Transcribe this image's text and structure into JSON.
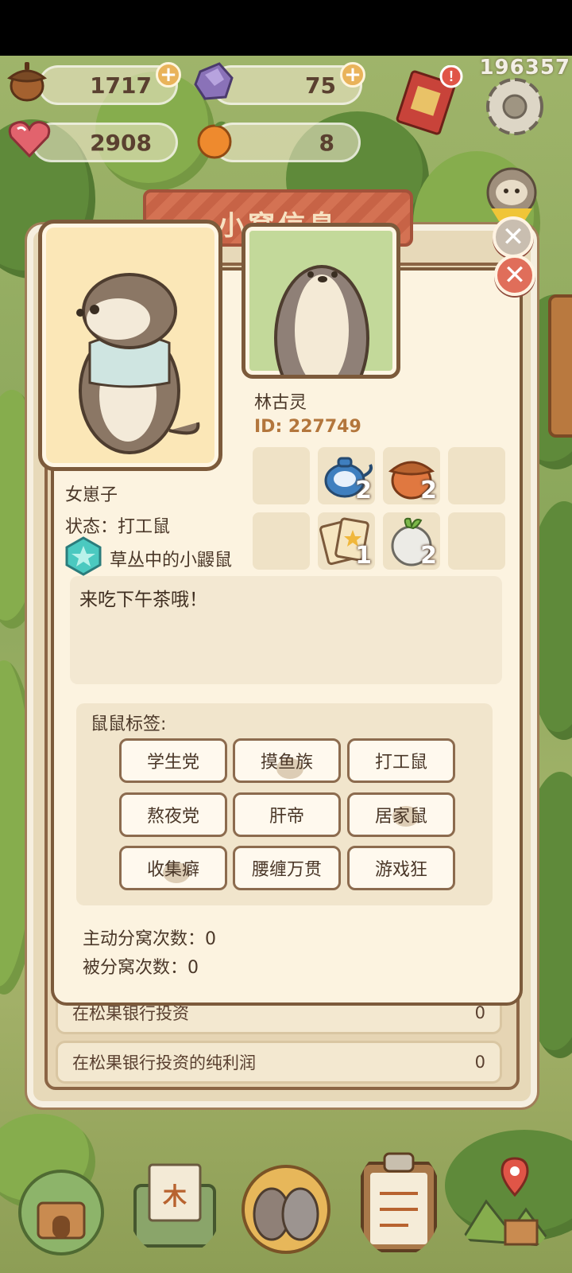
{
  "resources": [
    {
      "name": "acorn",
      "value": "1717"
    },
    {
      "name": "crystal",
      "value": "75"
    },
    {
      "name": "heart",
      "value": "2908"
    },
    {
      "name": "orange",
      "value": "8"
    }
  ],
  "player_id_corner": "196357",
  "back_panel": {
    "title": "小窝信息",
    "rows": [
      {
        "label": "在松果银行投资",
        "value": "0"
      },
      {
        "label": "在松果银行投资的纯利润",
        "value": "0"
      }
    ]
  },
  "profile": {
    "self_name": "女崽子",
    "status": "状态：打工鼠",
    "title_badge": "草丛中的小鼹鼠",
    "other_name": "林古灵",
    "other_id": "ID: 227749",
    "items": [
      {
        "name": "teapot",
        "count": "2"
      },
      {
        "name": "acorn",
        "count": "2"
      },
      {
        "name": "cards",
        "count": "1"
      },
      {
        "name": "turnip",
        "count": "2"
      }
    ],
    "message": "来吃下午茶哦！",
    "tags_title": "鼠鼠标签:",
    "tags": [
      "学生党",
      "摸鱼族",
      "打工鼠",
      "熬夜党",
      "肝帝",
      "居家鼠",
      "收集癖",
      "腰缠万贯",
      "游戏狂"
    ],
    "stats": {
      "active_split": "主动分窝次数：0",
      "passive_split": "被分窝次数：0"
    }
  },
  "colors": {
    "panel_bg": "#fcf3e0",
    "border": "#7c5a3b",
    "accent_id": "#b3763c",
    "close_red": "#e06e5a"
  }
}
